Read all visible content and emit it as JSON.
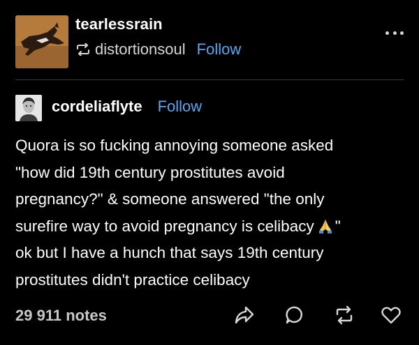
{
  "header": {
    "blog_name": "tearlessrain",
    "reblog_source": "distortionsoul",
    "follow_label": "Follow",
    "avatar_icon": "wolf-illustration-avatar",
    "more_icon": "more-dots-icon"
  },
  "post": {
    "author": "cordeliaflyte",
    "follow_label": "Follow",
    "avatar_icon": "portrait-avatar",
    "body_lines": [
      "Quora is so fucking annoying someone asked",
      "\"how did 19th century prostitutes avoid",
      "pregnancy?\" & someone answered \"the only",
      "surefire way to avoid pregnancy is celibacy",
      "ok but I have a hunch that says 19th century",
      "prostitutes didn't practice celibacy"
    ],
    "line4_suffix": "\"",
    "emoji": "folded-hands"
  },
  "footer": {
    "notes": "29 911 notes",
    "actions": [
      "share-icon",
      "reply-icon",
      "reblog-icon",
      "like-icon"
    ]
  },
  "colors": {
    "background": "#000000",
    "text": "#ffffff",
    "link": "#5aa7f0",
    "muted": "#c8c8c8"
  }
}
